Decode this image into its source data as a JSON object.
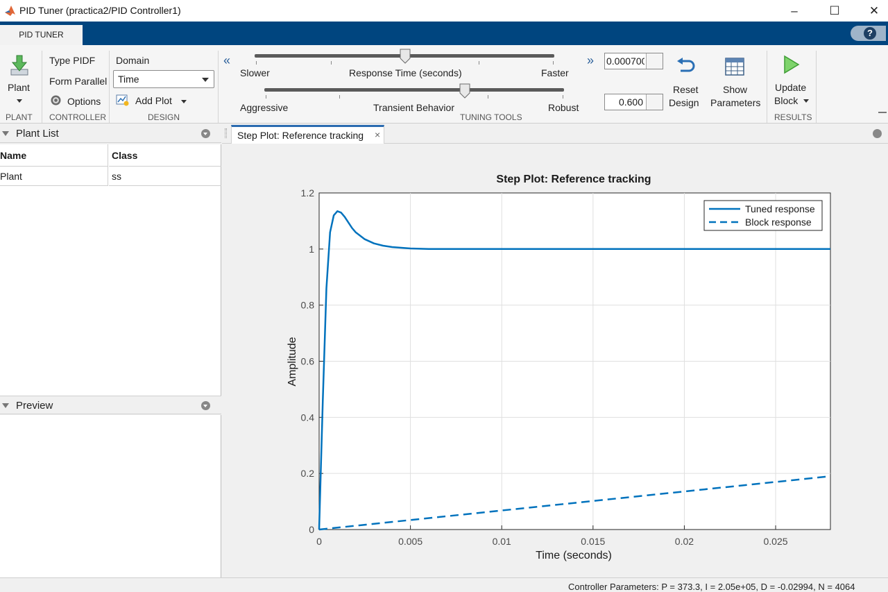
{
  "window": {
    "title": "PID Tuner (practica2/PID Controller1)",
    "minimize": "–",
    "maximize": "☐",
    "close": "✕"
  },
  "ribbon": {
    "tab": "PID TUNER",
    "help": "?",
    "plant": {
      "label": "Plant",
      "group": "PLANT"
    },
    "controller": {
      "type": "Type PIDF",
      "form": "Form Parallel",
      "options": "Options",
      "group": "CONTROLLER"
    },
    "design": {
      "domain_label": "Domain",
      "domain_value": "Time",
      "add_plot": "Add Plot",
      "group": "DESIGN"
    },
    "tuning": {
      "group": "TUNING TOOLS",
      "collapse_left": "«",
      "expand_right": "»",
      "slider1": {
        "left": "Slower",
        "center": "Response Time (seconds)",
        "right": "Faster",
        "value": "0.000700"
      },
      "slider2": {
        "left": "Aggressive",
        "center": "Transient Behavior",
        "right": "Robust",
        "value": "0.600"
      },
      "reset": [
        "Reset",
        "Design"
      ],
      "show": [
        "Show",
        "Parameters"
      ]
    },
    "results": {
      "update": [
        "Update",
        "Block"
      ],
      "group": "RESULTS"
    }
  },
  "plant_list": {
    "title": "Plant List",
    "columns": [
      "Name",
      "Class"
    ],
    "rows": [
      [
        "Plant",
        "ss"
      ]
    ]
  },
  "preview": {
    "title": "Preview"
  },
  "document": {
    "tab": "Step Plot: Reference tracking",
    "close": "×"
  },
  "status": {
    "text": "Controller Parameters: P = 373.3, I = 2.05e+05, D = -0.02994, N = 4064"
  },
  "colors": {
    "ribbon_blue": "#00457f",
    "series": "#0072bd",
    "accent_tab": "#2b6cb0"
  },
  "chart_data": {
    "type": "line",
    "title": "Step Plot: Reference tracking",
    "xlabel": "Time (seconds)",
    "ylabel": "Amplitude",
    "xlim": [
      0,
      0.028
    ],
    "ylim": [
      0,
      1.2
    ],
    "xticks": [
      0,
      0.005,
      0.01,
      0.015,
      0.02,
      0.025
    ],
    "xtick_labels": [
      "0",
      "0.005",
      "0.01",
      "0.015",
      "0.02",
      "0.025"
    ],
    "yticks": [
      0,
      0.2,
      0.4,
      0.6,
      0.8,
      1,
      1.2
    ],
    "ytick_labels": [
      "0",
      "0.2",
      "0.4",
      "0.6",
      "0.8",
      "1",
      "1.2"
    ],
    "grid": true,
    "legend": "top-right",
    "series": [
      {
        "name": "Tuned response",
        "style": "solid",
        "x": [
          0,
          0.0002,
          0.0004,
          0.0006,
          0.0008,
          0.001,
          0.0012,
          0.0014,
          0.0016,
          0.0018,
          0.002,
          0.0025,
          0.003,
          0.0035,
          0.004,
          0.005,
          0.006,
          0.007,
          0.008,
          0.01,
          0.015,
          0.02,
          0.025,
          0.028
        ],
        "y": [
          0,
          0.46,
          0.86,
          1.06,
          1.12,
          1.135,
          1.13,
          1.115,
          1.095,
          1.075,
          1.06,
          1.035,
          1.02,
          1.012,
          1.007,
          1.002,
          1.0,
          1.0,
          1.0,
          1.0,
          1.0,
          1.0,
          1.0,
          1.0
        ]
      },
      {
        "name": "Block response",
        "style": "dashed",
        "x": [
          0,
          0.028
        ],
        "y": [
          0,
          0.19
        ]
      }
    ]
  }
}
